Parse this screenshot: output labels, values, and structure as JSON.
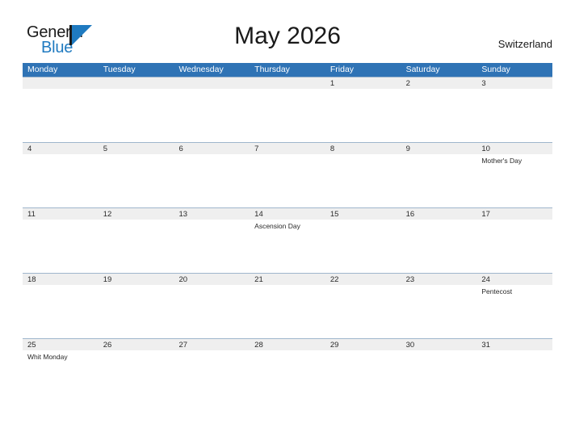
{
  "brand": {
    "word_one": "General",
    "word_two": "Blue",
    "mark": "triangle-logo",
    "accent_color": "#1f7ac0"
  },
  "header": {
    "title": "May 2026",
    "country": "Switzerland"
  },
  "theme": {
    "header_blue": "#2f73b5",
    "date_row_gray": "#efefef",
    "rule_color": "#9fb6cc",
    "text_color": "#2a2a2a"
  },
  "calendar": {
    "day_names": [
      "Monday",
      "Tuesday",
      "Wednesday",
      "Thursday",
      "Friday",
      "Saturday",
      "Sunday"
    ],
    "weeks": [
      {
        "days": [
          {
            "num": "",
            "event": ""
          },
          {
            "num": "",
            "event": ""
          },
          {
            "num": "",
            "event": ""
          },
          {
            "num": "",
            "event": ""
          },
          {
            "num": "1",
            "event": ""
          },
          {
            "num": "2",
            "event": ""
          },
          {
            "num": "3",
            "event": ""
          }
        ]
      },
      {
        "days": [
          {
            "num": "4",
            "event": ""
          },
          {
            "num": "5",
            "event": ""
          },
          {
            "num": "6",
            "event": ""
          },
          {
            "num": "7",
            "event": ""
          },
          {
            "num": "8",
            "event": ""
          },
          {
            "num": "9",
            "event": ""
          },
          {
            "num": "10",
            "event": "Mother's Day"
          }
        ]
      },
      {
        "days": [
          {
            "num": "11",
            "event": ""
          },
          {
            "num": "12",
            "event": ""
          },
          {
            "num": "13",
            "event": ""
          },
          {
            "num": "14",
            "event": "Ascension Day"
          },
          {
            "num": "15",
            "event": ""
          },
          {
            "num": "16",
            "event": ""
          },
          {
            "num": "17",
            "event": ""
          }
        ]
      },
      {
        "days": [
          {
            "num": "18",
            "event": ""
          },
          {
            "num": "19",
            "event": ""
          },
          {
            "num": "20",
            "event": ""
          },
          {
            "num": "21",
            "event": ""
          },
          {
            "num": "22",
            "event": ""
          },
          {
            "num": "23",
            "event": ""
          },
          {
            "num": "24",
            "event": "Pentecost"
          }
        ]
      },
      {
        "days": [
          {
            "num": "25",
            "event": "Whit Monday"
          },
          {
            "num": "26",
            "event": ""
          },
          {
            "num": "27",
            "event": ""
          },
          {
            "num": "28",
            "event": ""
          },
          {
            "num": "29",
            "event": ""
          },
          {
            "num": "30",
            "event": ""
          },
          {
            "num": "31",
            "event": ""
          }
        ]
      }
    ]
  }
}
